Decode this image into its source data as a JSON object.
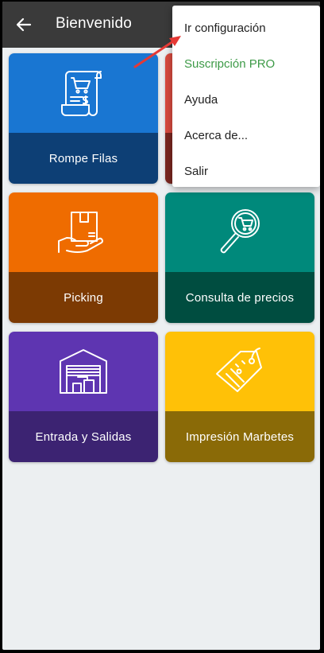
{
  "appbar": {
    "title": "Bienvenido",
    "back_icon": "arrow-left-icon"
  },
  "tiles": [
    {
      "label": "Rompe Filas",
      "icon": "receipt-cart-icon",
      "top_color": "#1976d2",
      "bottom_color": "#0d3f75"
    },
    {
      "label": "",
      "icon": "",
      "top_color": "#d84a3f",
      "bottom_color": "#7a2720"
    },
    {
      "label": "Picking",
      "icon": "hand-box-icon",
      "top_color": "#ef6c00",
      "bottom_color": "#7c3a03"
    },
    {
      "label": "Consulta de precios",
      "icon": "magnifier-cart-icon",
      "top_color": "#00897b",
      "bottom_color": "#004d40"
    },
    {
      "label": "Entrada y Salidas",
      "icon": "warehouse-icon",
      "top_color": "#5e35b1",
      "bottom_color": "#3c2372"
    },
    {
      "label": "Impresión Marbetes",
      "icon": "price-tag-icon",
      "top_color": "#ffc107",
      "bottom_color": "#8a6a07"
    }
  ],
  "menu": {
    "items": [
      {
        "label": "Ir configuración",
        "color": "#212121"
      },
      {
        "label": "Suscripción PRO",
        "color": "#3d9a47"
      },
      {
        "label": "Ayuda",
        "color": "#212121"
      },
      {
        "label": "Acerca de...",
        "color": "#212121"
      },
      {
        "label": "Salir",
        "color": "#212121"
      }
    ]
  },
  "annotation": {
    "arrow_color": "#e53935",
    "icon": "red-arrow-icon"
  }
}
